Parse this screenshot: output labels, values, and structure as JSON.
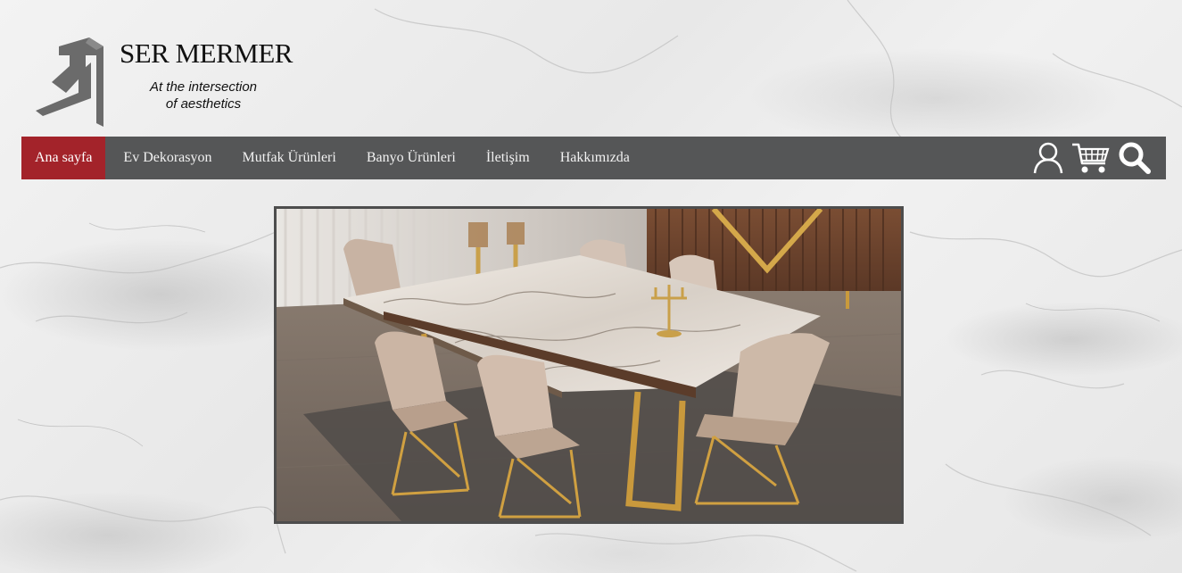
{
  "brand": {
    "name": "SER MERMER",
    "tagline_line1": "At the intersection",
    "tagline_line2": "of aesthetics"
  },
  "nav": {
    "items": [
      {
        "label": "Ana sayfa",
        "active": true
      },
      {
        "label": "Ev Dekorasyon",
        "active": false
      },
      {
        "label": "Mutfak Ürünleri",
        "active": false
      },
      {
        "label": "Banyo Ürünleri",
        "active": false
      },
      {
        "label": "İletişim",
        "active": false
      },
      {
        "label": "Hakkımızda",
        "active": false
      }
    ],
    "icons": [
      "user-icon",
      "cart-icon",
      "search-icon"
    ]
  },
  "hero": {
    "image": "dining-table-with-marble-top-and-chairs"
  },
  "colors": {
    "nav_bg": "#555657",
    "nav_active": "#a3232a",
    "nav_text": "#f2f2f2"
  }
}
